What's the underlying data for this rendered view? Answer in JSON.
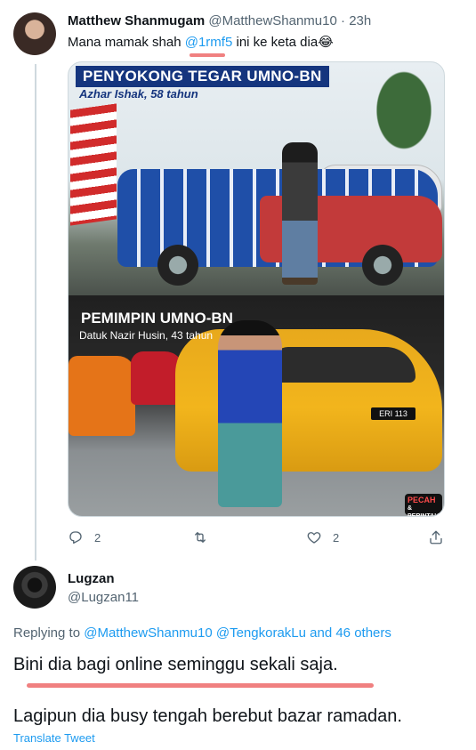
{
  "tweet1": {
    "display_name": "Matthew Shanmugam",
    "handle": "@MatthewShanmu10",
    "separator": "·",
    "time": "23h",
    "text_before": "Mana mamak shah ",
    "mention": "@1rmf5",
    "text_after": " ini ke keta dia😂",
    "media": {
      "banner_top": "PENYOKONG TEGAR UMNO-BN",
      "caption_top": "Azhar Ishak, 58 tahun",
      "banner_bottom": "PEMIMPIN UMNO-BN",
      "caption_bottom": "Datuk Nazir Husin, 43 tahun",
      "plate_text": "ERI 113",
      "brand_line1": "PECAH",
      "brand_line2": "& PERINTAH"
    },
    "actions": {
      "reply_count": "2",
      "retweet_count": "",
      "like_count": "2"
    }
  },
  "tweet2": {
    "display_name": "Lugzan",
    "handle": "@Lugzan11",
    "replying_prefix": "Replying to ",
    "replying_to": "@MatthewShanmu10 @TengkorakLu and 46 others",
    "line1": "Bini dia bagi online seminggu sekali saja.",
    "line2": "Lagipun dia busy tengah berebut bazar ramadan.",
    "translate": "Translate Tweet"
  },
  "colors": {
    "accent": "#1d9bf0",
    "secondary_text": "#536471",
    "highlight_underline": "#f08080"
  },
  "icons": [
    "reply-icon",
    "retweet-icon",
    "like-icon",
    "share-icon"
  ]
}
